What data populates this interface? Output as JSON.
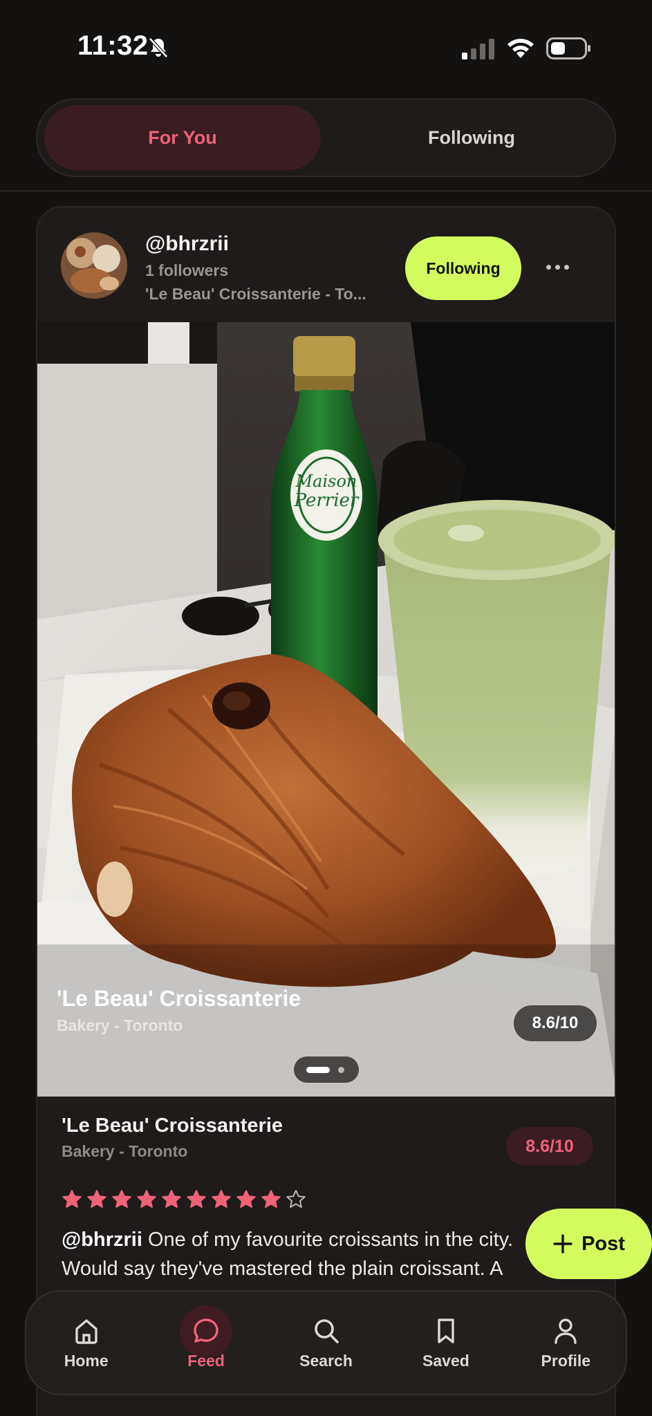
{
  "status_bar": {
    "time": "11:32"
  },
  "tabs": [
    {
      "label": "For You",
      "active": true
    },
    {
      "label": "Following",
      "active": false
    }
  ],
  "post": {
    "username": "@bhrzrii",
    "followers": "1 followers",
    "location_line": "'Le Beau' Croissanterie - To...",
    "follow_label": "Following",
    "photo_overlay": {
      "title": "'Le Beau' Croissanterie",
      "subtitle": "Bakery - Toronto",
      "score": "8.6/10"
    },
    "carousel": {
      "count": 2,
      "active_index": 0
    },
    "place_name": "'Le Beau' Croissanterie",
    "place_sub": "Bakery - Toronto",
    "score": "8.6/10",
    "stars": {
      "filled": 9,
      "total": 10
    },
    "review_author": "@bhrzrii",
    "review_text": " One of my favourite croissants in the city. Would say they've mastered the plain croissant. A"
  },
  "fab": {
    "label": "Post"
  },
  "nav": [
    {
      "label": "Home",
      "icon": "home-icon",
      "active": false
    },
    {
      "label": "Feed",
      "icon": "chat-bubble-icon",
      "active": true
    },
    {
      "label": "Search",
      "icon": "search-icon",
      "active": false
    },
    {
      "label": "Saved",
      "icon": "bookmark-icon",
      "active": false
    },
    {
      "label": "Profile",
      "icon": "person-icon",
      "active": false
    }
  ],
  "colors": {
    "accent_pink": "#f0627a",
    "accent_lime": "#d4fb5e",
    "background": "#141211",
    "card": "#1e1b1a"
  }
}
